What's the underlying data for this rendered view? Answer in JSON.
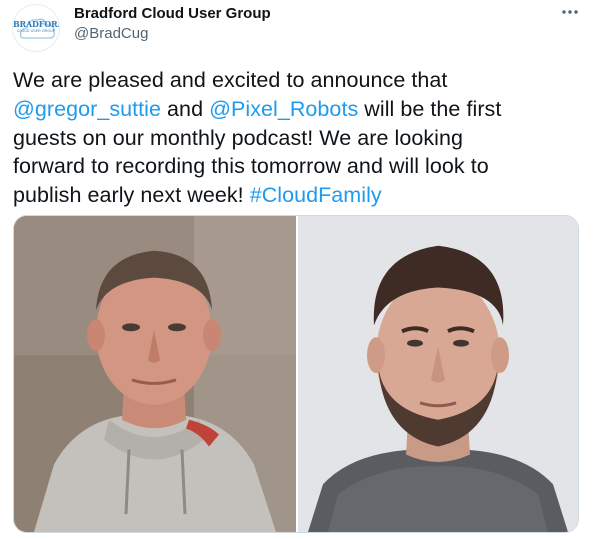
{
  "account": {
    "display_name": "Bradford Cloud User Group",
    "handle": "@BradCug",
    "avatar_text": "BRADFORD",
    "avatar_subtext": "CLOUD USER GROUP",
    "avatar_icon": "cloud-logo-icon"
  },
  "more_icon": "more-horizontal-icon",
  "tweet": {
    "lines": [
      [
        {
          "text": "We are pleased and excited to announce that",
          "link": false
        }
      ],
      [
        {
          "text": "@gregor_suttie",
          "link": true
        },
        {
          "text": " and ",
          "link": false
        },
        {
          "text": "@Pixel_Robots",
          "link": true
        },
        {
          "text": " will be the first",
          "link": false
        }
      ],
      [
        {
          "text": "guests on our monthly podcast!  We are looking",
          "link": false
        }
      ],
      [
        {
          "text": "forward to recording this tomorrow and will look to",
          "link": false
        }
      ],
      [
        {
          "text": "publish early next week! ",
          "link": false
        },
        {
          "text": "#CloudFamily",
          "link": true
        }
      ]
    ]
  },
  "media": {
    "photos": [
      {
        "name": "photo-gregor",
        "kind": "portrait-photo"
      },
      {
        "name": "photo-pixel-robots",
        "kind": "portrait-photo"
      }
    ]
  },
  "colors": {
    "link": "#1d9bf0",
    "text": "#0f1419",
    "secondary": "#536471"
  }
}
